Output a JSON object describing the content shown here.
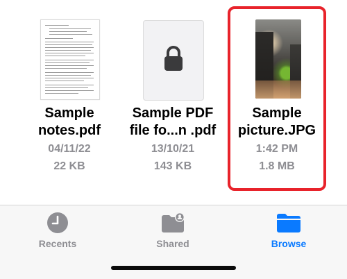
{
  "files": [
    {
      "name_line1": "Sample",
      "name_line2": "notes.pdf",
      "date": "04/11/22",
      "size": "22 KB",
      "thumbnail": "pdf-document-thumbnail"
    },
    {
      "name_line1": "Sample PDF",
      "name_line2": "file fo...n .pdf",
      "date": "13/10/21",
      "size": "143 KB",
      "thumbnail": "lock-icon"
    },
    {
      "name_line1": "Sample",
      "name_line2": "picture.JPG",
      "date": "1:42 PM",
      "size": "1.8 MB",
      "thumbnail": "photo-thumbnail",
      "highlighted": true
    }
  ],
  "tabs": [
    {
      "label": "Recents",
      "icon": "clock-icon",
      "active": false
    },
    {
      "label": "Shared",
      "icon": "shared-folder-icon",
      "active": false
    },
    {
      "label": "Browse",
      "icon": "folder-icon",
      "active": true
    }
  ],
  "colors": {
    "accent": "#0a7aff",
    "inactive": "#8e8e93",
    "selection": "#e8232b",
    "tab_bar_bg": "#f7f7f7"
  }
}
